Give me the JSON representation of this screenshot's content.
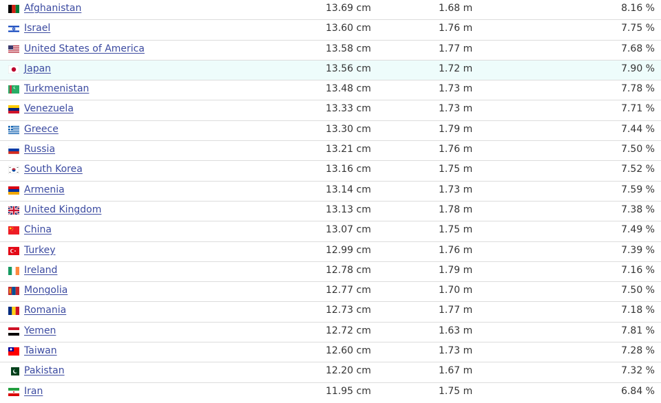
{
  "table": {
    "rows": [
      {
        "country": "Afghanistan",
        "length": "13.69 cm",
        "height": "1.68 m",
        "ratio": "8.16 %",
        "flag": "afghanistan-flag-icon"
      },
      {
        "country": "Israel",
        "length": "13.60 cm",
        "height": "1.76 m",
        "ratio": "7.75 %",
        "flag": "israel-flag-icon"
      },
      {
        "country": "United States of America",
        "length": "13.58 cm",
        "height": "1.77 m",
        "ratio": "7.68 %",
        "flag": "usa-flag-icon"
      },
      {
        "country": "Japan",
        "length": "13.56 cm",
        "height": "1.72 m",
        "ratio": "7.90 %",
        "flag": "japan-flag-icon"
      },
      {
        "country": "Turkmenistan",
        "length": "13.48 cm",
        "height": "1.73 m",
        "ratio": "7.78 %",
        "flag": "turkmenistan-flag-icon"
      },
      {
        "country": "Venezuela",
        "length": "13.33 cm",
        "height": "1.73 m",
        "ratio": "7.71 %",
        "flag": "venezuela-flag-icon"
      },
      {
        "country": "Greece",
        "length": "13.30 cm",
        "height": "1.79 m",
        "ratio": "7.44 %",
        "flag": "greece-flag-icon"
      },
      {
        "country": "Russia",
        "length": "13.21 cm",
        "height": "1.76 m",
        "ratio": "7.50 %",
        "flag": "russia-flag-icon"
      },
      {
        "country": "South Korea",
        "length": "13.16 cm",
        "height": "1.75 m",
        "ratio": "7.52 %",
        "flag": "south-korea-flag-icon"
      },
      {
        "country": "Armenia",
        "length": "13.14 cm",
        "height": "1.73 m",
        "ratio": "7.59 %",
        "flag": "armenia-flag-icon"
      },
      {
        "country": "United Kingdom",
        "length": "13.13 cm",
        "height": "1.78 m",
        "ratio": "7.38 %",
        "flag": "uk-flag-icon"
      },
      {
        "country": "China",
        "length": "13.07 cm",
        "height": "1.75 m",
        "ratio": "7.49 %",
        "flag": "china-flag-icon"
      },
      {
        "country": "Turkey",
        "length": "12.99 cm",
        "height": "1.76 m",
        "ratio": "7.39 %",
        "flag": "turkey-flag-icon"
      },
      {
        "country": "Ireland",
        "length": "12.78 cm",
        "height": "1.79 m",
        "ratio": "7.16 %",
        "flag": "ireland-flag-icon"
      },
      {
        "country": "Mongolia",
        "length": "12.77 cm",
        "height": "1.70 m",
        "ratio": "7.50 %",
        "flag": "mongolia-flag-icon"
      },
      {
        "country": "Romania",
        "length": "12.73 cm",
        "height": "1.77 m",
        "ratio": "7.18 %",
        "flag": "romania-flag-icon"
      },
      {
        "country": "Yemen",
        "length": "12.72 cm",
        "height": "1.63 m",
        "ratio": "7.81 %",
        "flag": "yemen-flag-icon"
      },
      {
        "country": "Taiwan",
        "length": "12.60 cm",
        "height": "1.73 m",
        "ratio": "7.28 %",
        "flag": "taiwan-flag-icon"
      },
      {
        "country": "Pakistan",
        "length": "12.20 cm",
        "height": "1.67 m",
        "ratio": "7.32 %",
        "flag": "pakistan-flag-icon"
      },
      {
        "country": "Iran",
        "length": "11.95 cm",
        "height": "1.75 m",
        "ratio": "6.84 %",
        "flag": "iran-flag-icon"
      }
    ]
  },
  "colors": {
    "link": "#3b4aa0",
    "text": "#333333",
    "row_highlight": "#eefcfb",
    "row_border": "#dcdcdc"
  }
}
